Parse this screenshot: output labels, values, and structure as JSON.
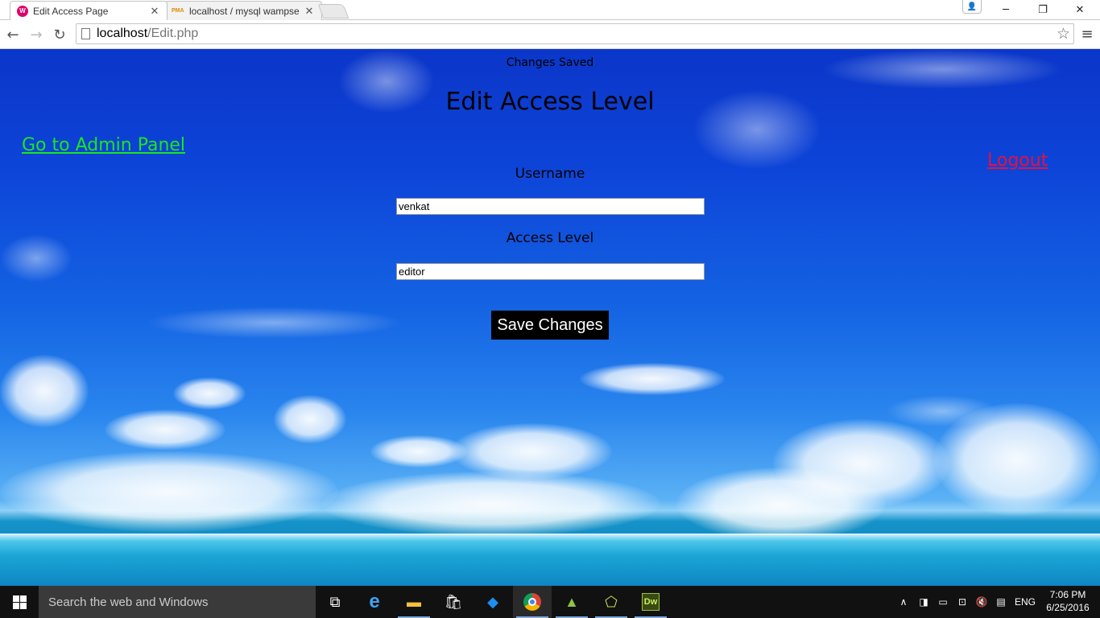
{
  "browser": {
    "tabs": [
      {
        "title": "Edit Access Page",
        "favicon": "wamp-icon",
        "active": true
      },
      {
        "title": "localhost / mysql wampse",
        "favicon": "phpmyadmin-icon",
        "active": false
      }
    ],
    "url_host": "localhost",
    "url_path": "/Edit.php"
  },
  "page": {
    "status_message": "Changes Saved",
    "title": "Edit Access Level",
    "admin_link": "Go to Admin Panel",
    "logout_link": "Logout",
    "form": {
      "username_label": "Username",
      "username_value": "venkat",
      "access_label": "Access Level",
      "access_value": "editor",
      "save_label": "Save Changes"
    },
    "colors": {
      "admin_link": "#19e81b",
      "logout_link": "#e8103f",
      "button_bg": "#000000",
      "button_text": "#ffffff"
    }
  },
  "taskbar": {
    "search_placeholder": "Search the web and Windows",
    "pinned": [
      "task-view-icon",
      "edge-icon",
      "file-explorer-icon",
      "store-icon",
      "dropbox-icon",
      "chrome-icon",
      "android-studio-icon",
      "phpstorm-icon",
      "dreamweaver-icon"
    ],
    "dreamweaver_label": "Dw",
    "tray": {
      "language": "ENG",
      "time": "7:06 PM",
      "date": "6/25/2016"
    }
  }
}
